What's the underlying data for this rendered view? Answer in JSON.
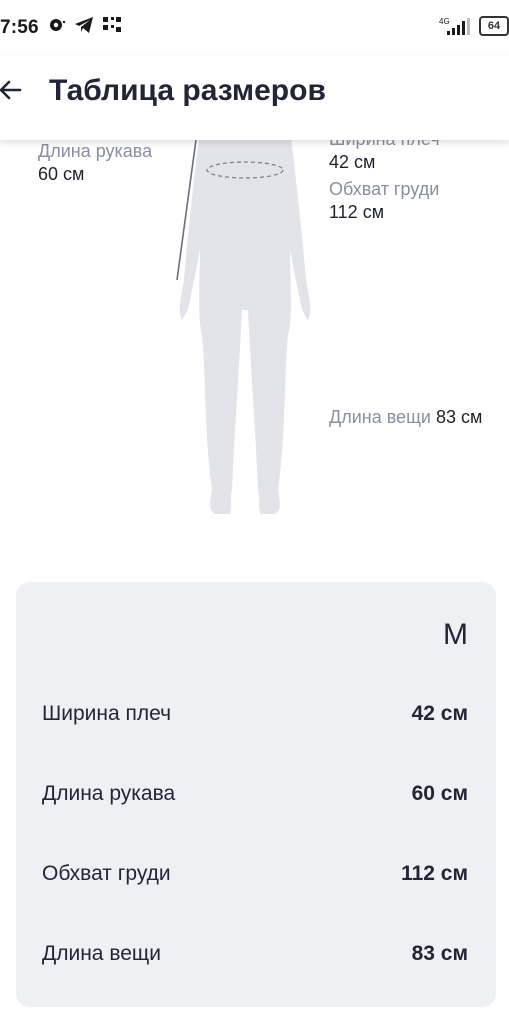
{
  "status_bar": {
    "time": "7:56",
    "network": "4G",
    "battery": "64"
  },
  "app_bar": {
    "title": "Таблица размеров"
  },
  "figure": {
    "sleeve": {
      "label": "Длина рукава",
      "value": "60 см"
    },
    "shoulder": {
      "label": "Ширина плеч",
      "value": "42 см"
    },
    "chest": {
      "label": "Обхват груди",
      "value": "112 см"
    },
    "length": {
      "label": "Длина вещи",
      "value": "83 см"
    }
  },
  "size_table": {
    "size": "M",
    "rows": [
      {
        "name": "Ширина плеч",
        "value": "42 см"
      },
      {
        "name": "Длина рукава",
        "value": "60 см"
      },
      {
        "name": "Обхват груди",
        "value": "112 см"
      },
      {
        "name": "Длина вещи",
        "value": "83 см"
      }
    ]
  },
  "colors": {
    "card_bg": "#eff0f4",
    "silhouette": "#e3e3ea",
    "label_gray": "#8b8ea3",
    "text_dark": "#232536"
  }
}
